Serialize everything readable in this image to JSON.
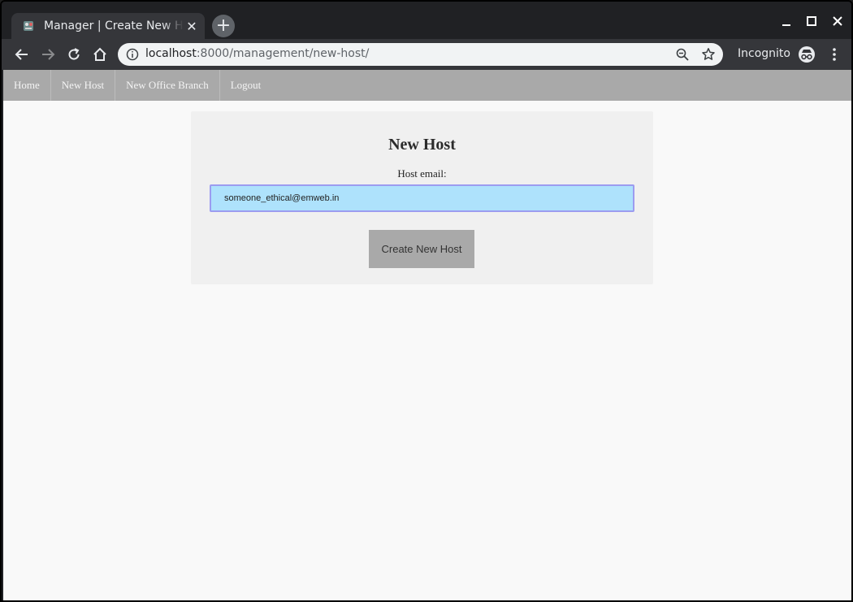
{
  "browser": {
    "tab_title": "Manager | Create New Host",
    "tab_close": "✕",
    "new_tab": "+",
    "url_host": "localhost",
    "url_path": ":8000/management/new-host/",
    "incognito_label": "Incognito"
  },
  "navbar": {
    "links": [
      "Home",
      "New Host",
      "New Office Branch",
      "Logout"
    ]
  },
  "form": {
    "title": "New Host",
    "email_label": "Host email:",
    "email_value": "someone_ethical@emweb.in",
    "submit_label": "Create New Host"
  }
}
